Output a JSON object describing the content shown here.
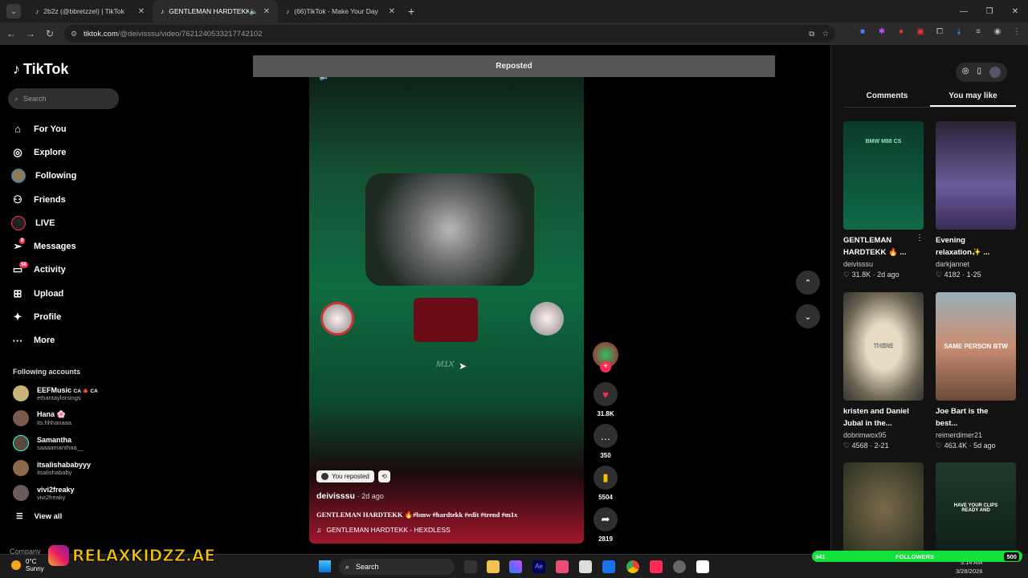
{
  "browser": {
    "tabs": [
      {
        "title": "2b2z (@bbretzzel) | TikTok"
      },
      {
        "title": "GENTLEMAN HARDTEKK"
      },
      {
        "title": "(66)TikTok - Make Your Day"
      }
    ],
    "url_host": "tiktok.com",
    "url_path": "/@deivisssu/video/7621240533217742102"
  },
  "sidebar": {
    "logo": "TikTok",
    "search_placeholder": "Search",
    "items": [
      {
        "label": "For You",
        "icon": "home-icon"
      },
      {
        "label": "Explore",
        "icon": "compass-icon"
      },
      {
        "label": "Following",
        "icon": "following-avatar-icon"
      },
      {
        "label": "Friends",
        "icon": "friends-icon"
      },
      {
        "label": "LIVE",
        "icon": "live-icon"
      },
      {
        "label": "Messages",
        "icon": "messages-icon",
        "badge": "8"
      },
      {
        "label": "Activity",
        "icon": "activity-icon",
        "badge": "58"
      },
      {
        "label": "Upload",
        "icon": "upload-icon"
      },
      {
        "label": "Profile",
        "icon": "profile-icon"
      },
      {
        "label": "More",
        "icon": "more-icon"
      }
    ],
    "following_title": "Following accounts",
    "accounts": [
      {
        "name": "EEFMusic",
        "flags": "CA 🍁 CA",
        "handle": "ethantaylorsings"
      },
      {
        "name": "Hana",
        "flags": "🌸",
        "handle": "its.hhhanaaa"
      },
      {
        "name": "Samantha",
        "flags": "",
        "handle": "saaaamanthaa__"
      },
      {
        "name": "itsalishababyyy",
        "flags": "",
        "handle": "itsalishababy"
      },
      {
        "name": "vivi2freaky",
        "flags": "",
        "handle": "vivi2freaky"
      }
    ],
    "view_all": "View all",
    "company": "Company"
  },
  "player": {
    "reposted_banner": "Reposted",
    "you_reposted": "You reposted",
    "author": "deivisssu",
    "posted": "2d ago",
    "description": "GENTLEMAN HARDTEKK 🔥#bmw #hardtekk #edit #trend #m1x",
    "music": "GENTLEMAN HARDTEKK - HEXDLESS",
    "likes": "31.8K",
    "comments": "350",
    "saves": "5504",
    "shares": "2819"
  },
  "right_panel": {
    "tabs": [
      "Comments",
      "You may like"
    ],
    "active_tab": "You may like",
    "cards": [
      {
        "title1": "GENTLEMAN",
        "title2": "HARDTEKK 🔥 ...",
        "user": "deivisssu",
        "likes": "31.8K",
        "date": "2d ago",
        "overlay": "BMW M88 CS"
      },
      {
        "title1": "Evening",
        "title2": "relaxation✨ ...",
        "user": "darkjannet",
        "likes": "4182",
        "date": "1-25",
        "overlay": ""
      },
      {
        "title1": "kristen and Daniel",
        "title2": "Jubal in the...",
        "user": "dobrimwox95",
        "likes": "4568",
        "date": "2-21",
        "overlay": "THERE"
      },
      {
        "title1": "Joe Bart is the",
        "title2": "best...",
        "user": "reimerdimer21",
        "likes": "463.4K",
        "date": "5d ago",
        "overlay": "SAME PERSON BTW"
      },
      {
        "title1": "",
        "title2": "",
        "user": "",
        "likes": "",
        "date": "",
        "overlay": ""
      },
      {
        "title1": "",
        "title2": "",
        "user": "",
        "likes": "",
        "date": "",
        "overlay": "HAVE YOUR CLIPS READY AND"
      }
    ]
  },
  "taskbar": {
    "weather_temp": "0°C",
    "weather_desc": "Sunny",
    "search": "Search",
    "time": "3:14 AM",
    "date": "3/28/2026"
  },
  "overlays": {
    "brand": "RELAXKIDZZ.AE",
    "followers_label": "FOLLOWERS",
    "followers_left": "341",
    "followers_right": "500",
    "video_watermark": "M1X"
  }
}
